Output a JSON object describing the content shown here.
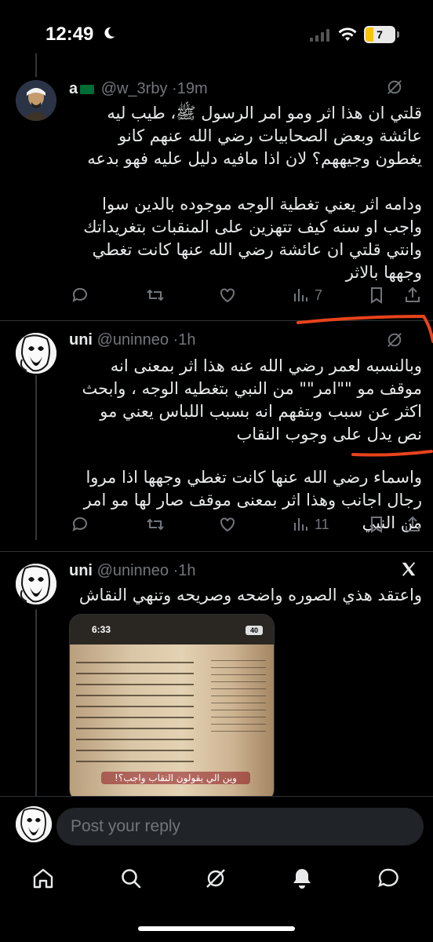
{
  "status_bar": {
    "time": "12:49",
    "battery": "7",
    "battery_level": 0.07
  },
  "tweets": [
    {
      "name": "a",
      "handle": "@w_3rby",
      "time": "19m",
      "text": "قلتي ان هذا اثر ومو امر الرسول ﷺ، طيب ليه عائشة وبعض الصحابيات رضي الله عنهم كانو يغطون وجيههم؟ لان اذا مافيه دليل عليه فهو بدعه\n\nودامه اثر يعني تغطية الوجه موجوده بالدين سوا واجب او سنه كيف تتهزين على المنقبات بتغريداتك وانتي قلتي ان عائشة رضي الله عنها كانت تغطي وجهها بالاثر",
      "views": "7"
    },
    {
      "name": "uni",
      "handle": "@uninneo",
      "time": "1h",
      "text": "وبالنسبه لعمر رضي الله عنه هذا اثر بمعنى انه موقف مو \"\"امر\"\" من النبي بتغطيه الوجه ، وابحث اكثر عن سبب وبتفهم انه بسبب اللباس يعني مو نص يدل على وجوب النقاب",
      "text2": "واسماء رضي الله عنها كانت تغطي وجهها اذا مروا رجال اجانب وهذا اثر بمعنى موقف صار لها مو امر من النبي",
      "views": "11"
    },
    {
      "name": "uni",
      "handle": "@uninneo",
      "time": "1h",
      "text": "واعتقد هذي الصوره واضحه وصريحه وتنهي النقاش",
      "media": {
        "time": "6:33",
        "battery": "40",
        "caption": "وين الي يقولون النقاب واجب؟!"
      }
    }
  ],
  "reply": {
    "placeholder": "Post your reply"
  },
  "nav": [
    "home-icon",
    "search-icon",
    "grok-icon",
    "notifications-icon",
    "messages-icon"
  ],
  "colors": {
    "background": "#000000",
    "text": "#e7e9ea",
    "muted": "#71767b",
    "divider": "#2f3336",
    "annotation": "#e8431c"
  }
}
